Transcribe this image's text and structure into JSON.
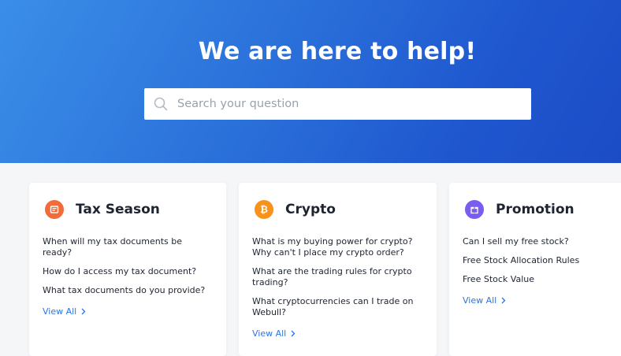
{
  "hero": {
    "title": "We are here to help!",
    "search_placeholder": "Search your question",
    "gradient_start": "#3a8ee8",
    "gradient_end": "#1b4cc6"
  },
  "categories": [
    {
      "title": "Tax Season",
      "icon": "tax-document-icon",
      "icon_color": "#f26b3a",
      "questions": [
        "When will my tax documents be ready?",
        "How do I access my tax document?",
        "What tax documents do you provide?"
      ],
      "view_all": "View All"
    },
    {
      "title": "Crypto",
      "icon": "bitcoin-icon",
      "icon_color": "#f7931a",
      "questions": [
        "What is my buying power for crypto? Why can't I place my crypto order?",
        "What are the trading rules for crypto trading?",
        "What cryptocurrencies can I trade on Webull?"
      ],
      "view_all": "View All"
    },
    {
      "title": "Promotion",
      "icon": "gift-icon",
      "icon_color": "#7b5cf0",
      "questions": [
        "Can I sell my free stock?",
        "Free Stock Allocation Rules",
        "Free Stock Value"
      ],
      "view_all": "View All"
    }
  ],
  "link_color": "#2b74e2"
}
